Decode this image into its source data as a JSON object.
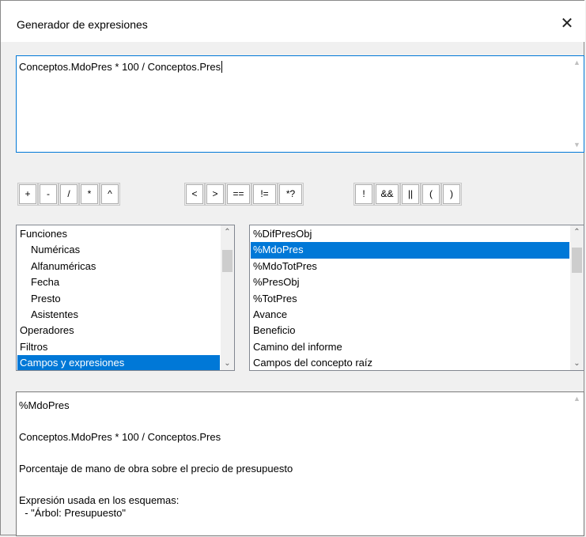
{
  "window": {
    "title": "Generador de expresiones",
    "close_glyph": "✕"
  },
  "expression": {
    "value": "Conceptos.MdoPres * 100 / Conceptos.Pres"
  },
  "operators": {
    "arith": [
      "+",
      "-",
      "/",
      "*",
      "^"
    ],
    "compare": [
      "<",
      ">",
      "==",
      "!=",
      "*?"
    ],
    "logic": [
      "!",
      "&&",
      "||",
      "(",
      ")"
    ]
  },
  "categories": {
    "items": [
      {
        "label": "Funciones"
      },
      {
        "label": "Numéricas"
      },
      {
        "label": "Alfanuméricas"
      },
      {
        "label": "Fecha"
      },
      {
        "label": "Presto"
      },
      {
        "label": "Asistentes"
      },
      {
        "label": "Operadores"
      },
      {
        "label": "Filtros"
      },
      {
        "label": "Campos y expresiones"
      }
    ],
    "selected": "Campos y expresiones"
  },
  "fields": {
    "items": [
      {
        "label": "%DifPresObj"
      },
      {
        "label": "%MdoPres"
      },
      {
        "label": "%MdoTotPres"
      },
      {
        "label": "%PresObj"
      },
      {
        "label": "%TotPres"
      },
      {
        "label": "Avance"
      },
      {
        "label": "Beneficio"
      },
      {
        "label": "Camino del informe"
      },
      {
        "label": "Campos del concepto raíz"
      }
    ],
    "selected": "%MdoPres"
  },
  "description": {
    "name": "%MdoPres",
    "expression": "Conceptos.MdoPres * 100 / Conceptos.Pres",
    "summary": "Porcentaje de mano de obra sobre el precio de presupuesto",
    "usage_heading": "Expresión usada en los esquemas:",
    "usage_item": "  - \"Árbol: Presupuesto\""
  },
  "icons": {
    "scroll_up": "chevron-up-icon",
    "scroll_down": "chevron-down-icon",
    "close": "close-icon"
  }
}
